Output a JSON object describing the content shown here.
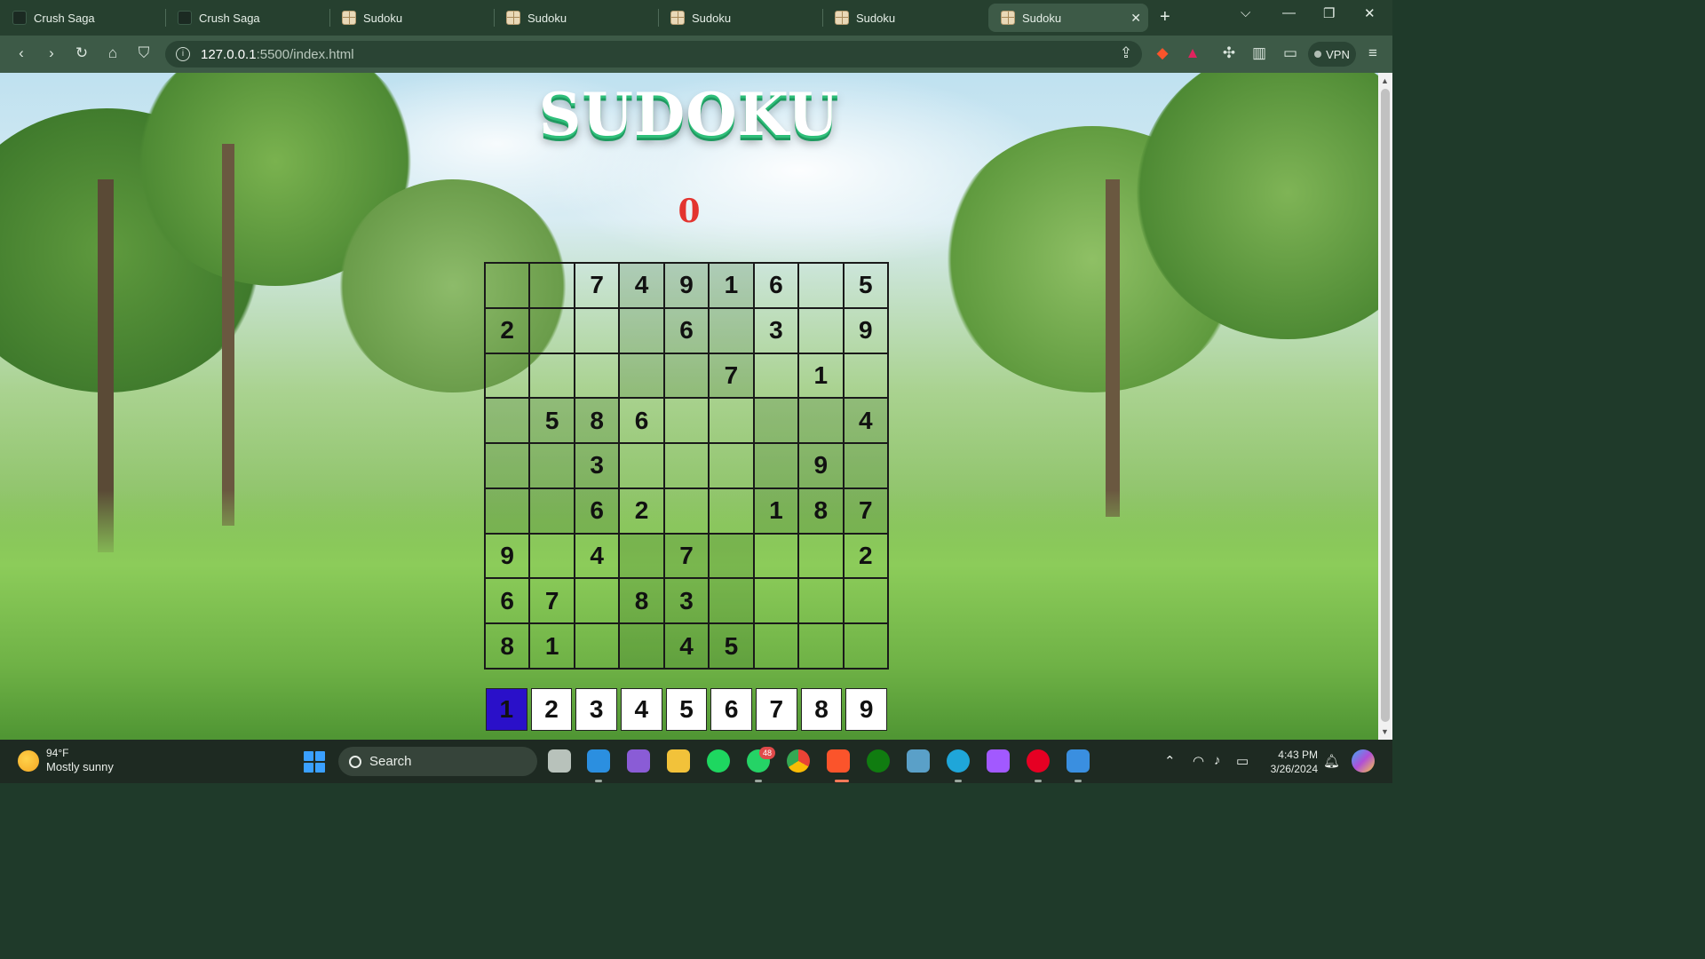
{
  "browser": {
    "tabs": [
      {
        "label": "Crush Saga",
        "favicon": "crush-saga-favicon",
        "active": false
      },
      {
        "label": "Crush Saga",
        "favicon": "crush-saga-favicon",
        "active": false
      },
      {
        "label": "Sudoku",
        "favicon": "sudoku-favicon",
        "active": false
      },
      {
        "label": "Sudoku",
        "favicon": "sudoku-favicon",
        "active": false
      },
      {
        "label": "Sudoku",
        "favicon": "sudoku-favicon",
        "active": false
      },
      {
        "label": "Sudoku",
        "favicon": "sudoku-favicon",
        "active": false
      },
      {
        "label": "Sudoku",
        "favicon": "sudoku-favicon",
        "active": true
      }
    ],
    "address": {
      "host": "127.0.0.1",
      "path": ":5500/index.html"
    },
    "vpn_label": "VPN"
  },
  "game": {
    "title": "SUDOKU",
    "score": "0",
    "board": [
      [
        "",
        "",
        "7",
        "4",
        "9",
        "1",
        "6",
        "",
        "5"
      ],
      [
        "2",
        "",
        "",
        "",
        "6",
        "",
        "3",
        "",
        "9"
      ],
      [
        "",
        "",
        "",
        "",
        "",
        "7",
        "",
        "1",
        ""
      ],
      [
        "",
        "5",
        "8",
        "6",
        "",
        "",
        "",
        "",
        "4"
      ],
      [
        "",
        "",
        "3",
        "",
        "",
        "",
        "",
        "9",
        ""
      ],
      [
        "",
        "",
        "6",
        "2",
        "",
        "",
        "1",
        "8",
        "7"
      ],
      [
        "9",
        "",
        "4",
        "",
        "7",
        "",
        "",
        "",
        "2"
      ],
      [
        "6",
        "7",
        "",
        "8",
        "3",
        "",
        "",
        "",
        ""
      ],
      [
        "8",
        "1",
        "",
        "",
        "4",
        "5",
        "",
        "",
        ""
      ]
    ],
    "digits": [
      "1",
      "2",
      "3",
      "4",
      "5",
      "6",
      "7",
      "8",
      "9"
    ],
    "selected_digit": "1",
    "colors": {
      "title": "#ffffff",
      "title_shadow": "#2fbf7a",
      "score": "#e3342f",
      "selected": "#2a10c9"
    }
  },
  "taskbar": {
    "weather": {
      "temp": "94°F",
      "condition": "Mostly sunny"
    },
    "search_label": "Search",
    "whatsapp_badge": "48",
    "time": "4:43 PM",
    "date": "3/26/2024"
  }
}
